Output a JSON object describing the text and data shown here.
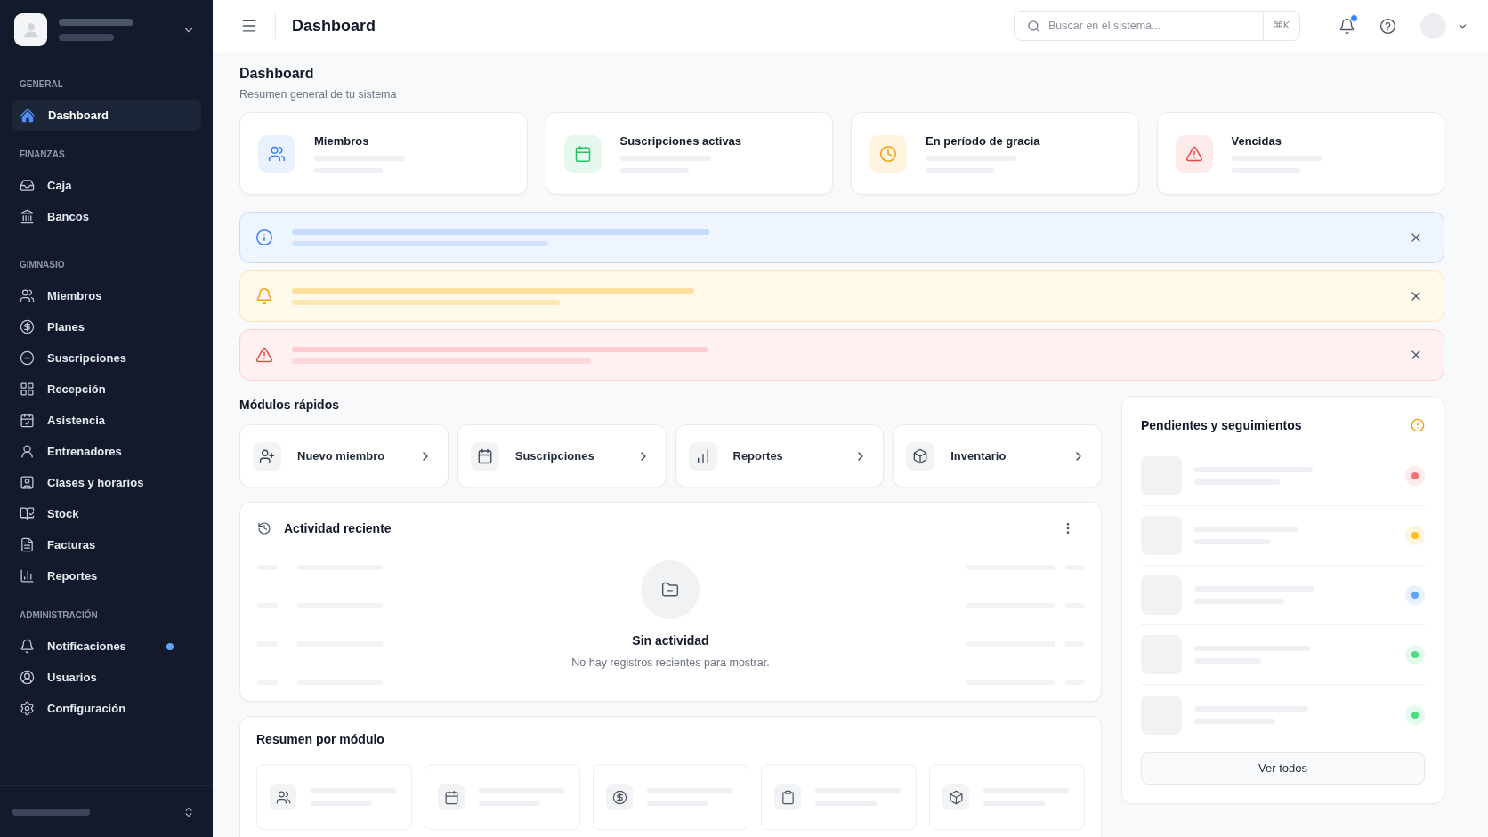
{
  "sidebar": {
    "sections": [
      {
        "title": "GENERAL",
        "items": [
          {
            "label": "Dashboard",
            "selected": true,
            "unread": false
          }
        ]
      },
      {
        "title": "FINANZAS",
        "items": [
          {
            "label": "Caja",
            "selected": false,
            "unread": false
          },
          {
            "label": "Bancos",
            "selected": false,
            "unread": false
          }
        ]
      },
      {
        "title": "GIMNASIO",
        "items": [
          {
            "label": "Miembros",
            "selected": false,
            "unread": false
          },
          {
            "label": "Planes",
            "selected": false,
            "unread": false
          },
          {
            "label": "Suscripciones",
            "selected": false,
            "unread": false
          },
          {
            "label": "Recepción",
            "selected": false,
            "unread": false
          },
          {
            "label": "Asistencia",
            "selected": false,
            "unread": false
          },
          {
            "label": "Entrenadores",
            "selected": false,
            "unread": false
          },
          {
            "label": "Clases y horarios",
            "selected": false,
            "unread": false
          },
          {
            "label": "Stock",
            "selected": false,
            "unread": false
          },
          {
            "label": "Facturas",
            "selected": false,
            "unread": false
          },
          {
            "label": "Reportes",
            "selected": false,
            "unread": false
          }
        ]
      },
      {
        "title": "ADMINISTRACIÓN",
        "items": [
          {
            "label": "Notificaciones",
            "selected": false,
            "unread": true
          },
          {
            "label": "Usuarios",
            "selected": false,
            "unread": false
          },
          {
            "label": "Configuración",
            "selected": false,
            "unread": false
          }
        ]
      }
    ]
  },
  "header": {
    "title": "Dashboard",
    "search": {
      "placeholder": "Buscar en el sistema...",
      "shortcut": "⌘K"
    },
    "notifications": {
      "unread": true
    }
  },
  "page": {
    "title": "Dashboard",
    "subtitle": "Resumen general de tu sistema"
  },
  "stat_cards": [
    {
      "label": "Miembros"
    },
    {
      "label": "Suscripciones activas"
    },
    {
      "label": "En período de gracia"
    },
    {
      "label": "Vencidas"
    }
  ],
  "alerts": [
    {
      "kind": "info"
    },
    {
      "kind": "warning"
    },
    {
      "kind": "danger"
    }
  ],
  "quick_modules": {
    "title": "Módulos rápidos",
    "items": [
      {
        "label": "Nuevo miembro"
      },
      {
        "label": "Suscripciones"
      },
      {
        "label": "Reportes"
      },
      {
        "label": "Inventario"
      }
    ]
  },
  "recent_activity": {
    "title": "Actividad reciente",
    "empty_title": "Sin actividad",
    "empty_message": "No hay registros recientes para mostrar."
  },
  "module_summary": {
    "title": "Resumen por módulo"
  },
  "pending": {
    "title": "Pendientes y seguimientos",
    "items": [
      {
        "color": "#f87171"
      },
      {
        "color": "#fbbf24"
      },
      {
        "color": "#60a5fa"
      },
      {
        "color": "#4ade80"
      },
      {
        "color": "#4ade80"
      }
    ],
    "button": "Ver todos"
  }
}
